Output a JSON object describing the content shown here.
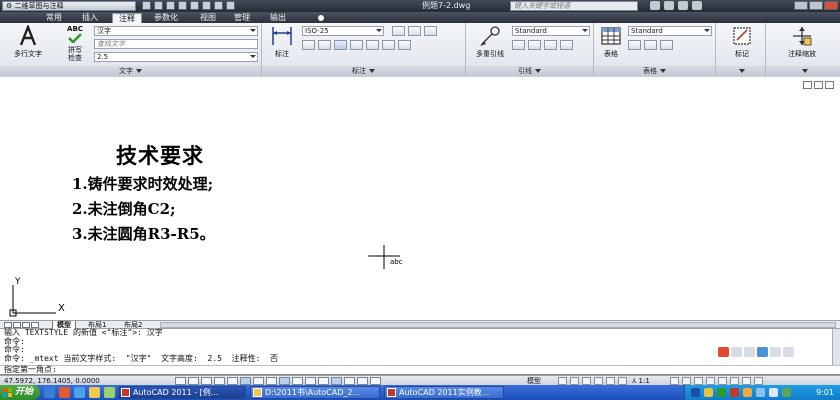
{
  "title_bar": {
    "workspace": "二维草图与注释",
    "document_title": "例题7-2.dwg",
    "search_placeholder": "键入关键字或短语"
  },
  "ribbon_tabs": [
    "常用",
    "插入",
    "注释",
    "参数化",
    "视图",
    "管理",
    "输出"
  ],
  "active_tab": "注释",
  "ribbon": {
    "text_panel": {
      "title": "文字",
      "mtext_label": "多行文字",
      "spellcheck_label": "拼写检查",
      "abc": "ABC",
      "style_value": "汉字",
      "find_placeholder": "查找文字",
      "height_value": "2.5"
    },
    "dim_panel": {
      "title": "标注",
      "dim_label": "标注",
      "style_value": "ISO-25"
    },
    "leader_panel": {
      "title": "引线",
      "mleader_label": "多重引线",
      "style_value": "Standard"
    },
    "table_panel": {
      "title": "表格",
      "table_label": "表格",
      "style_value": "Standard"
    },
    "mark_panel": {
      "label": "标记"
    },
    "scale_panel": {
      "label": "注释缩放"
    }
  },
  "drawing": {
    "mtext_title": "技术要求",
    "mtext_lines": [
      "1.铸件要求时效处理;",
      "2.未注倒角C2;",
      "3.未注圆角R3-R5。"
    ],
    "cursor_label": "abc",
    "ucs_y": "Y",
    "ucs_x": "X"
  },
  "layout_tabs": [
    "模型",
    "布局1",
    "布局2"
  ],
  "command_lines": [
    "输入 TEXTSTYLE 的新值 <\"标注\">: 汉字",
    "命令:",
    "命令:",
    "命令: _mtext 当前文字样式:  \"汉字\"  文字高度:  2.5  注释性:  否",
    "指定第一角点:"
  ],
  "status": {
    "coords": "47.5972,  176.1405,  0.0000",
    "model": "模型",
    "scale": "1:1"
  },
  "taskbar": {
    "start": "开始",
    "tasks": [
      "AutoCAD 2011 - [例...",
      "D:\\2011书\\AutoCAD_2...",
      "AutoCAD 2011实例教..."
    ],
    "clock": "9:01"
  },
  "colors": {
    "title_bar": "#2f3440",
    "ribbon": "#e8ebf0",
    "taskbar": "#2a5fc8",
    "start": "#3c9a36"
  }
}
